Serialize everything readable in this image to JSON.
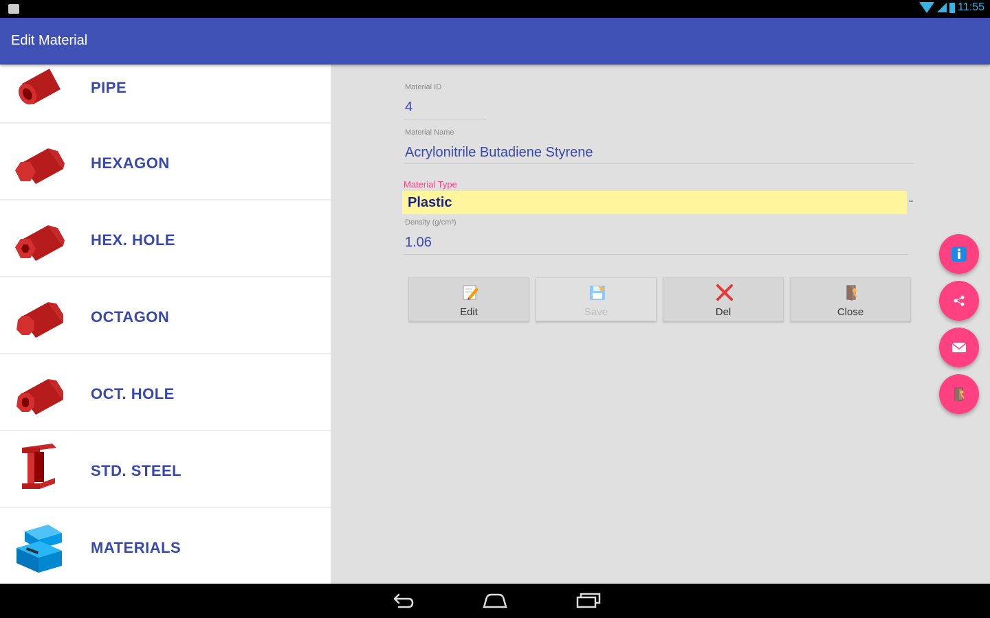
{
  "status_bar": {
    "time": "11:55"
  },
  "app_bar": {
    "title": "Edit Material"
  },
  "sidebar": {
    "items": [
      {
        "label": "PIPE",
        "icon": "pipe-icon"
      },
      {
        "label": "HEXAGON",
        "icon": "hexagon-bar-icon"
      },
      {
        "label": "HEX. HOLE",
        "icon": "hex-hole-icon"
      },
      {
        "label": "OCTAGON",
        "icon": "octagon-bar-icon"
      },
      {
        "label": "OCT. HOLE",
        "icon": "oct-hole-icon"
      },
      {
        "label": "STD. STEEL",
        "icon": "i-beam-icon"
      },
      {
        "label": "MATERIALS",
        "icon": "toolbox-icon"
      }
    ]
  },
  "form": {
    "material_id_label": "Material ID",
    "material_id_value": "4",
    "material_name_label": "Material Name",
    "material_name_value": "Acrylonitrile Butadiene Styrene",
    "material_type_label": "Material Type",
    "material_type_value": "Plastic",
    "density_label": "Density (g/cm³)",
    "density_value": "1.06"
  },
  "buttons": {
    "edit": "Edit",
    "save": "Save",
    "del": "Del",
    "close": "Close"
  },
  "fabs": [
    "info-icon",
    "share-icon",
    "mail-icon",
    "exit-icon"
  ],
  "colors": {
    "app_bar": "#3f51b5",
    "accent": "#ff4081",
    "label_text": "#3949ab",
    "select_highlight": "#fff59d"
  }
}
